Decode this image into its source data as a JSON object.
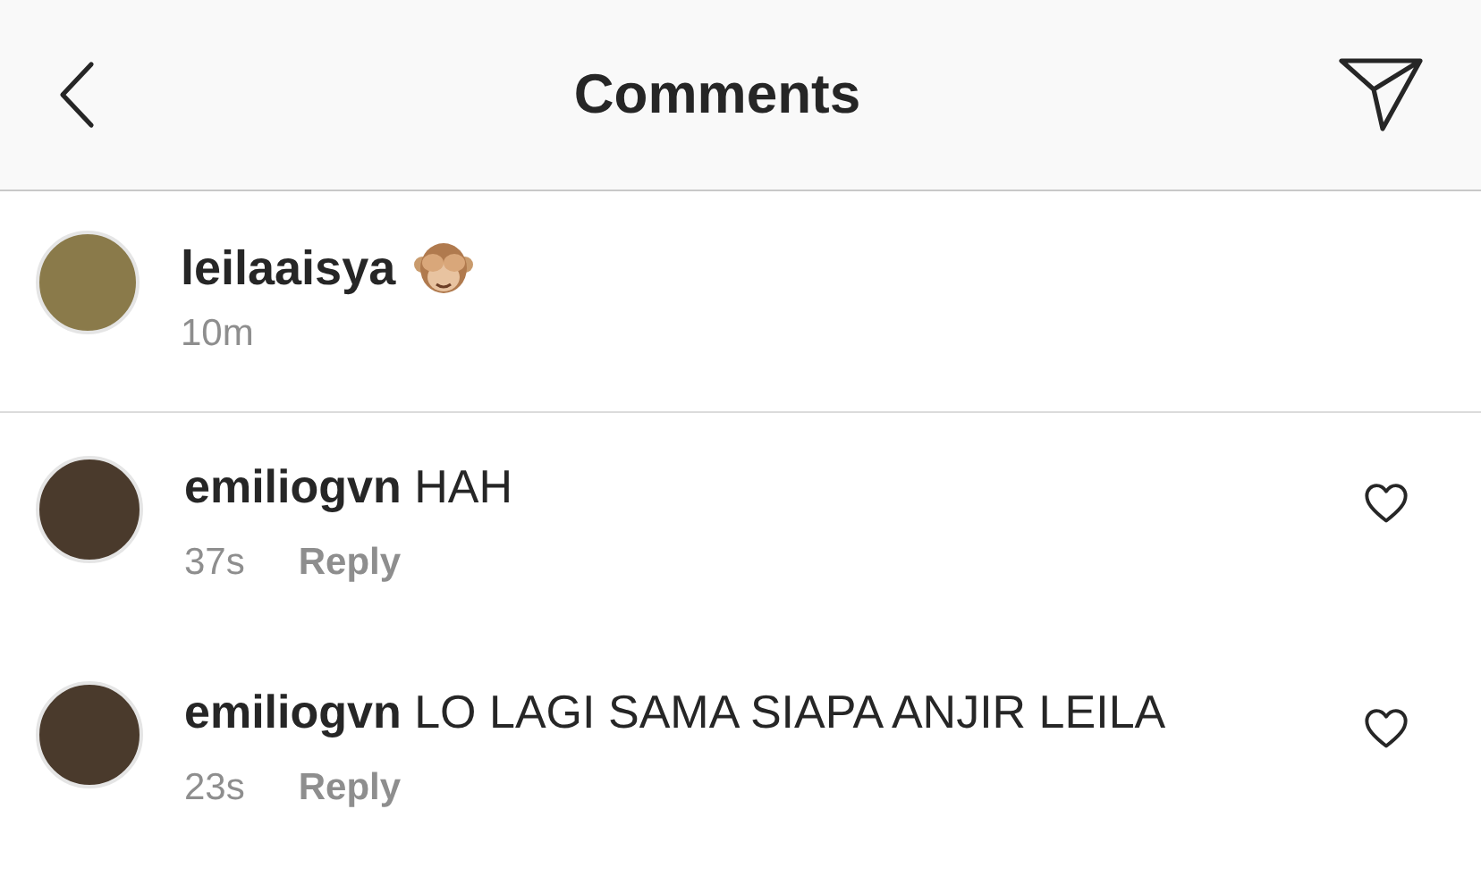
{
  "header": {
    "title": "Comments"
  },
  "caption": {
    "username": "leilaaisya",
    "time": "10m"
  },
  "comments": [
    {
      "username": "emiliogvn",
      "text": "HAH",
      "time": "37s",
      "reply": "Reply",
      "liked": false
    },
    {
      "username": "emiliogvn",
      "text": "LO LAGI SAMA SIAPA ANJIR LEILA",
      "time": "23s",
      "reply": "Reply",
      "liked": false
    }
  ]
}
